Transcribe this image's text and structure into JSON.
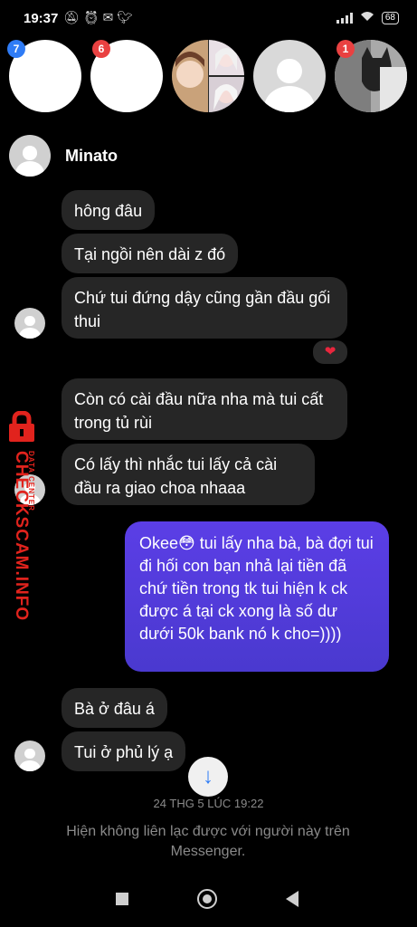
{
  "status_bar": {
    "time": "19:37",
    "left_icons": [
      "notifications-off-icon",
      "alarm-icon",
      "messenger-icon",
      "twitter-icon"
    ],
    "battery": "68"
  },
  "stories": [
    {
      "badge": "7",
      "badge_color": "#2f7cf6"
    },
    {
      "badge": "6",
      "badge_color": "#e94141"
    },
    {
      "badge": ""
    },
    {
      "badge": ""
    },
    {
      "badge": "1",
      "badge_color": "#e94141"
    }
  ],
  "conversation": {
    "name": "Minato"
  },
  "messages": {
    "m1": "hông đâu",
    "m2": "Tại ngồi nên dài z đó",
    "m3": "Chứ tui đứng dậy cũng gần đầu gối thui",
    "m3_reaction": "❤",
    "m4": "Còn có cài đầu nữa nha mà tui cất trong tủ rùi",
    "m5": "Có lấy thì nhắc tui lấy cả cài đầu ra giao choa nhaaa",
    "sent1": "Okee😳 tui lấy nha bà, bà đợi tui đi hối con bạn nhả lại tiền đã chứ tiền trong tk tui hiện k ck được á tại ck xong là số dư dưới 50k bank nó k cho=))))",
    "m6": "Bà ở đâu á",
    "m7": "Tui ở phủ lý ạ"
  },
  "timestamp": "24 THG 5 LÚC 19:22",
  "notice": "Hiện không liên lạc được với người này trên Messenger.",
  "watermark": {
    "main": "CHECKSCAM.INFO",
    "small": "DATA CENTER"
  },
  "colors": {
    "sent_bubble": "#4a39cf",
    "received_bubble": "#262626",
    "watermark": "#e1231d"
  }
}
